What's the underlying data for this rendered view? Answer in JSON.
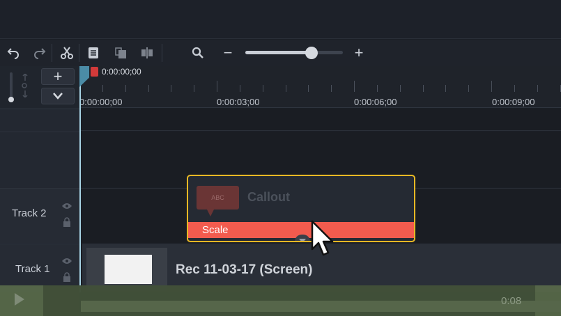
{
  "toolbar": {
    "buttons": [
      "undo-icon",
      "redo-icon",
      "cut-icon",
      "paste-icon",
      "copy-icon",
      "split-icon"
    ],
    "zoom_out_label": "−",
    "zoom_in_label": "+",
    "zoom_level": 0.68
  },
  "timeline": {
    "add_track_label": "+",
    "collapse_label": "⌄",
    "playhead_time": "0:00:00;00",
    "ruler_labels": [
      "0:00:00;00",
      "0:00:03;00",
      "0:00:06;00",
      "0:00:09;00"
    ]
  },
  "tracks": [
    {
      "label": "Track 2"
    },
    {
      "label": "Track 1"
    }
  ],
  "clips": {
    "callout": {
      "thumb_text": "ABC",
      "title": "Callout",
      "effect": "Scale"
    },
    "recording": {
      "title": "Rec 11-03-17 (Screen)"
    }
  },
  "player": {
    "time": "0:08"
  },
  "colors": {
    "accent_yellow": "#e8b824",
    "effect_red": "#f25b4e",
    "playhead_blue": "#4b8ca6"
  }
}
